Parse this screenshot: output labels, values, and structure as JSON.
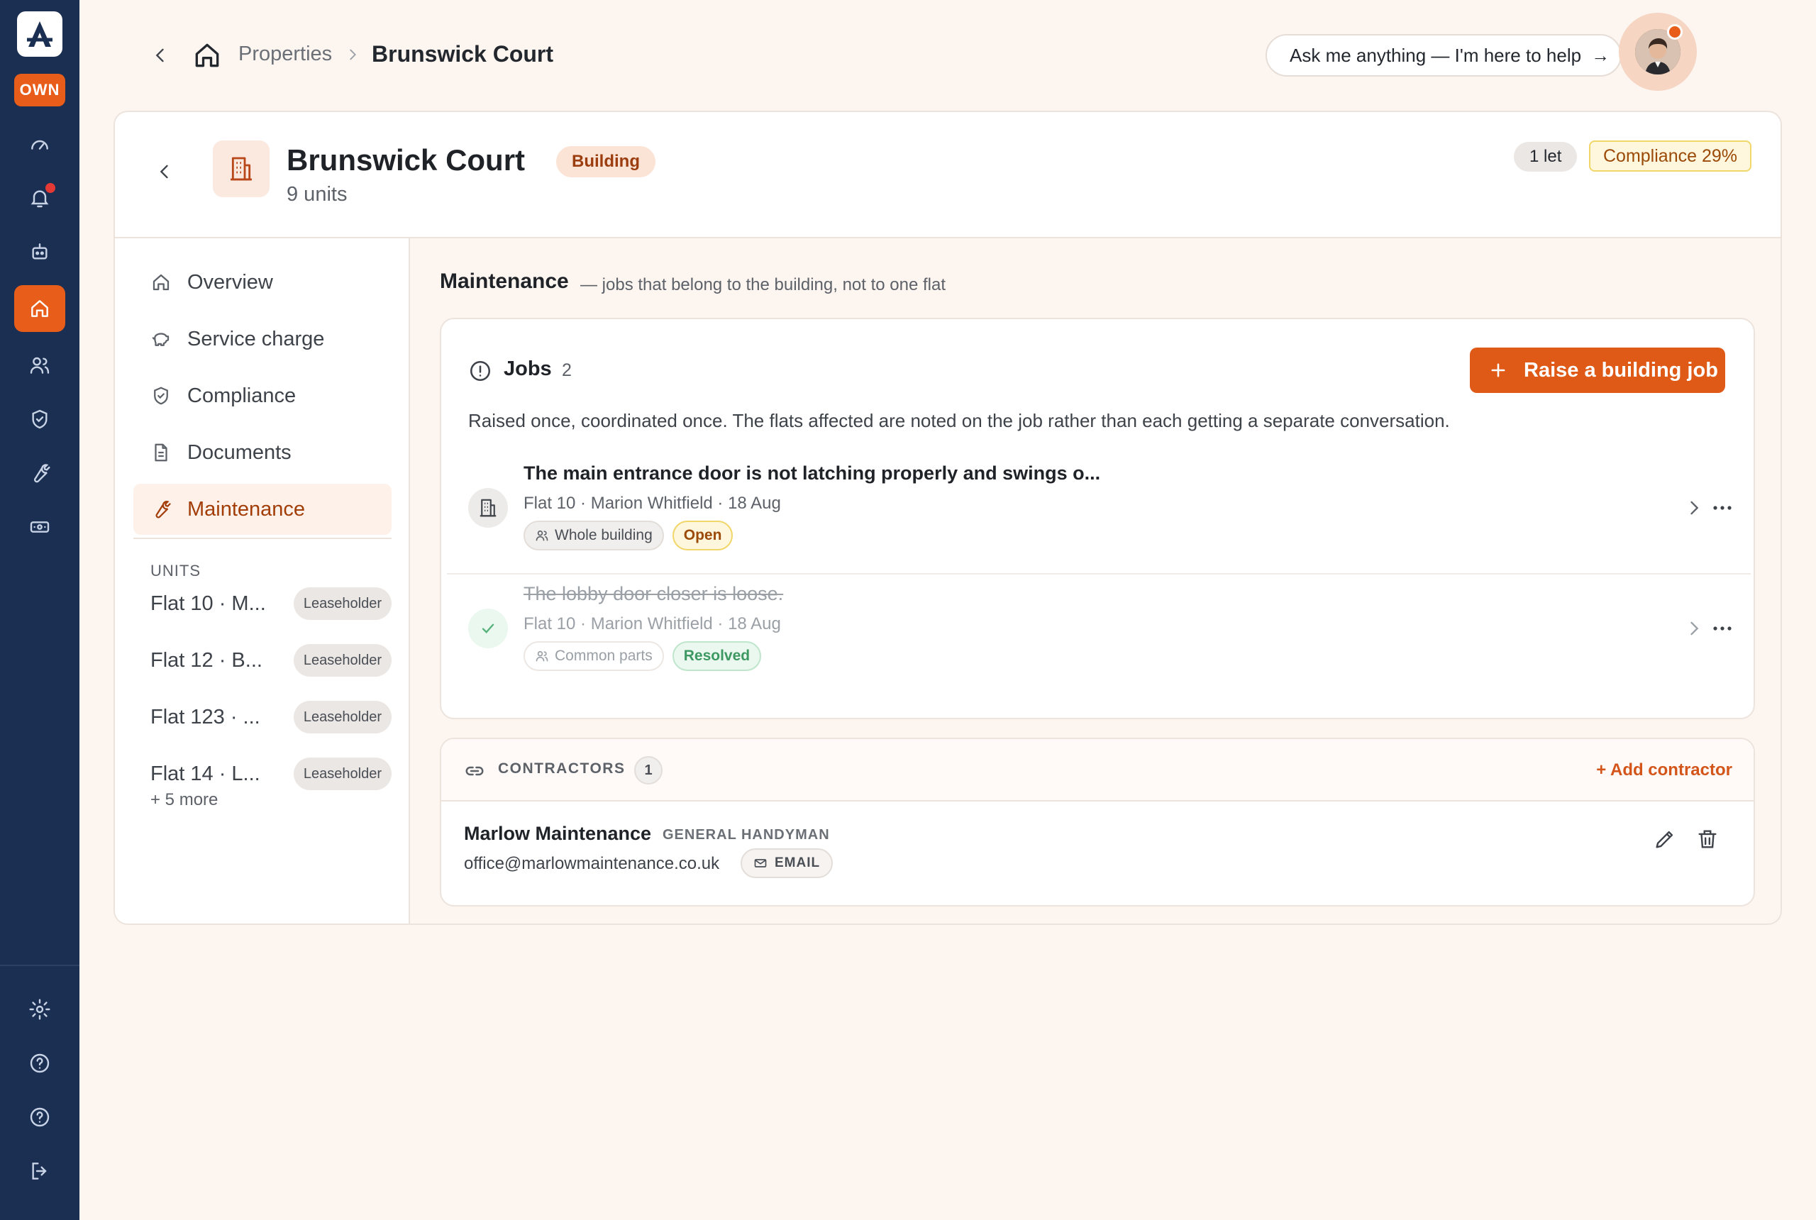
{
  "rail": {
    "logo_letter": "A",
    "mode_badge": "OWN",
    "icons": [
      "dashboard-icon",
      "bell-icon",
      "robot-icon",
      "home-icon",
      "users-icon",
      "shield-icon",
      "wrench-icon",
      "ticket-icon",
      "settings-icon",
      "help-icon",
      "help-icon",
      "logout-icon"
    ],
    "accent": "#e85d1a"
  },
  "header": {
    "breadcrumb_parent": "Properties",
    "breadcrumb_current": "Brunswick Court",
    "ask_placeholder": "Ask me anything — I'm here to help",
    "ask_arrow": "→"
  },
  "property": {
    "name": "Brunswick Court",
    "units_label": "9 units",
    "type_tag": "Building",
    "let_badge": "1 let",
    "compliance_badge": "Compliance 29%"
  },
  "nav": {
    "items": [
      {
        "label": "Overview",
        "icon": "home-icon"
      },
      {
        "label": "Service charge",
        "icon": "piggy-bank-icon"
      },
      {
        "label": "Compliance",
        "icon": "shield-check-icon"
      },
      {
        "label": "Documents",
        "icon": "document-icon"
      },
      {
        "label": "Maintenance",
        "icon": "wrench-icon",
        "active": true
      }
    ],
    "units_heading": "UNITS",
    "units": [
      {
        "name": "Flat 10 · M...",
        "tag": "Leaseholder"
      },
      {
        "name": "Flat 12 · B...",
        "tag": "Leaseholder"
      },
      {
        "name": "Flat 123 · ...",
        "tag": "Leaseholder"
      },
      {
        "name": "Flat 14 · L...",
        "tag": "Leaseholder"
      }
    ],
    "more_link": "+ 5 more"
  },
  "maintenance": {
    "title": "Maintenance",
    "subtitle": "— jobs that belong to the building, not to one flat",
    "jobs_title": "Jobs",
    "jobs_count": "2",
    "raise_button": "Raise a building job",
    "jobs_description": "Raised once, coordinated once. The flats affected are noted on the job rather than each getting a separate conversation.",
    "jobs": [
      {
        "title": "The main entrance door is not latching properly and swings o...",
        "meta": "Flat 10 · Marion Whitfield · 18 Aug",
        "scope": "Whole building",
        "status": "Open",
        "resolved": false
      },
      {
        "title": "The lobby door closer is loose.",
        "meta": "Flat 10 · Marion Whitfield · 18 Aug",
        "scope": "Common parts",
        "status": "Resolved",
        "resolved": true
      }
    ]
  },
  "contractors": {
    "heading": "CONTRACTORS",
    "count": "1",
    "add_link": "+ Add contractor",
    "items": [
      {
        "name": "Marlow Maintenance",
        "role": "GENERAL HANDYMAN",
        "email": "office@marlowmaintenance.co.uk",
        "contact_tag": "EMAIL"
      }
    ]
  }
}
